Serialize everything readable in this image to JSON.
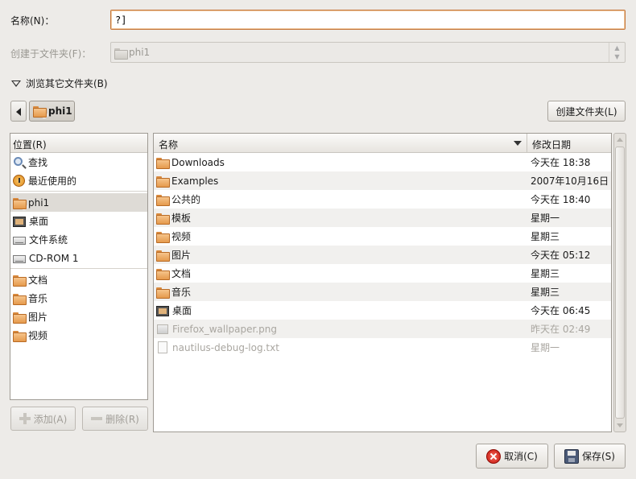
{
  "form": {
    "name_label": "名称(N)：",
    "name_value": "?]",
    "create_in_label": "创建于文件夹(F)：",
    "create_in_value": "phi1",
    "browse_label": "浏览其它文件夹(B)"
  },
  "pathbar": {
    "current": "phi1",
    "create_folder_label": "创建文件夹(L)"
  },
  "places": {
    "header": "位置(R)",
    "items": [
      {
        "label": "查找",
        "icon": "search-icon"
      },
      {
        "label": "最近使用的",
        "icon": "recent-icon"
      },
      {
        "label": "phi1",
        "icon": "home-folder-icon"
      },
      {
        "label": "桌面",
        "icon": "desktop-icon"
      },
      {
        "label": "文件系统",
        "icon": "drive-icon"
      },
      {
        "label": "CD-ROM 1",
        "icon": "cdrom-icon"
      },
      {
        "label": "文档",
        "icon": "folder-icon"
      },
      {
        "label": "音乐",
        "icon": "folder-icon"
      },
      {
        "label": "图片",
        "icon": "folder-icon"
      },
      {
        "label": "视频",
        "icon": "folder-icon"
      }
    ],
    "add_label": "添加(A)",
    "remove_label": "删除(R)"
  },
  "files": {
    "col_name": "名称",
    "col_date": "修改日期",
    "rows": [
      {
        "name": "Downloads",
        "date": "今天在 18:38",
        "icon": "folder-icon"
      },
      {
        "name": "Examples",
        "date": "2007年10月16日",
        "icon": "folder-icon"
      },
      {
        "name": "公共的",
        "date": "今天在 18:40",
        "icon": "folder-icon"
      },
      {
        "name": "模板",
        "date": "星期一",
        "icon": "folder-icon"
      },
      {
        "name": "视频",
        "date": "星期三",
        "icon": "folder-icon"
      },
      {
        "name": "图片",
        "date": "今天在 05:12",
        "icon": "folder-icon"
      },
      {
        "name": "文档",
        "date": "星期三",
        "icon": "folder-icon"
      },
      {
        "name": "音乐",
        "date": "星期三",
        "icon": "folder-icon"
      },
      {
        "name": "桌面",
        "date": "今天在 06:45",
        "icon": "desktop-icon"
      },
      {
        "name": "Firefox_wallpaper.png",
        "date": "昨天在 02:49",
        "icon": "image-file-icon"
      },
      {
        "name": "nautilus-debug-log.txt",
        "date": "星期一",
        "icon": "text-file-icon"
      }
    ]
  },
  "buttons": {
    "cancel": "取消(C)",
    "save": "保存(S)"
  }
}
